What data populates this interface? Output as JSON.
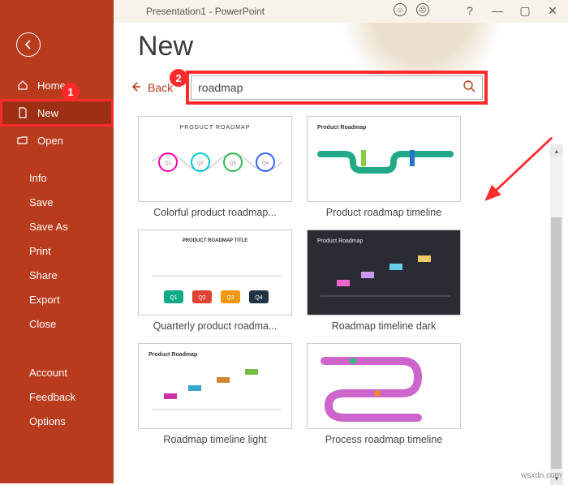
{
  "titlebar": {
    "title": "Presentation1 - PowerPoint"
  },
  "sidebar": {
    "home": "Home",
    "new": "New",
    "open": "Open",
    "menu": [
      "Info",
      "Save",
      "Save As",
      "Print",
      "Share",
      "Export",
      "Close"
    ],
    "footer": [
      "Account",
      "Feedback",
      "Options"
    ]
  },
  "page": {
    "title": "New",
    "back_label": "Back",
    "search_value": "roadmap"
  },
  "templates": [
    {
      "label": "Colorful product roadmap...",
      "heading": "PRODUCT ROADMAP"
    },
    {
      "label": "Product roadmap timeline",
      "heading": "Product Roadmap"
    },
    {
      "label": "Quarterly product roadma...",
      "heading": "PRODUCT ROADMAP TITLE"
    },
    {
      "label": "Roadmap timeline dark",
      "heading": "Product Roadmap"
    },
    {
      "label": "Roadmap timeline light",
      "heading": "Product Roadmap"
    },
    {
      "label": "Process roadmap timeline",
      "heading": ""
    }
  ],
  "callouts": {
    "c1": "1",
    "c2": "2"
  },
  "watermark": "wsxdn.com"
}
